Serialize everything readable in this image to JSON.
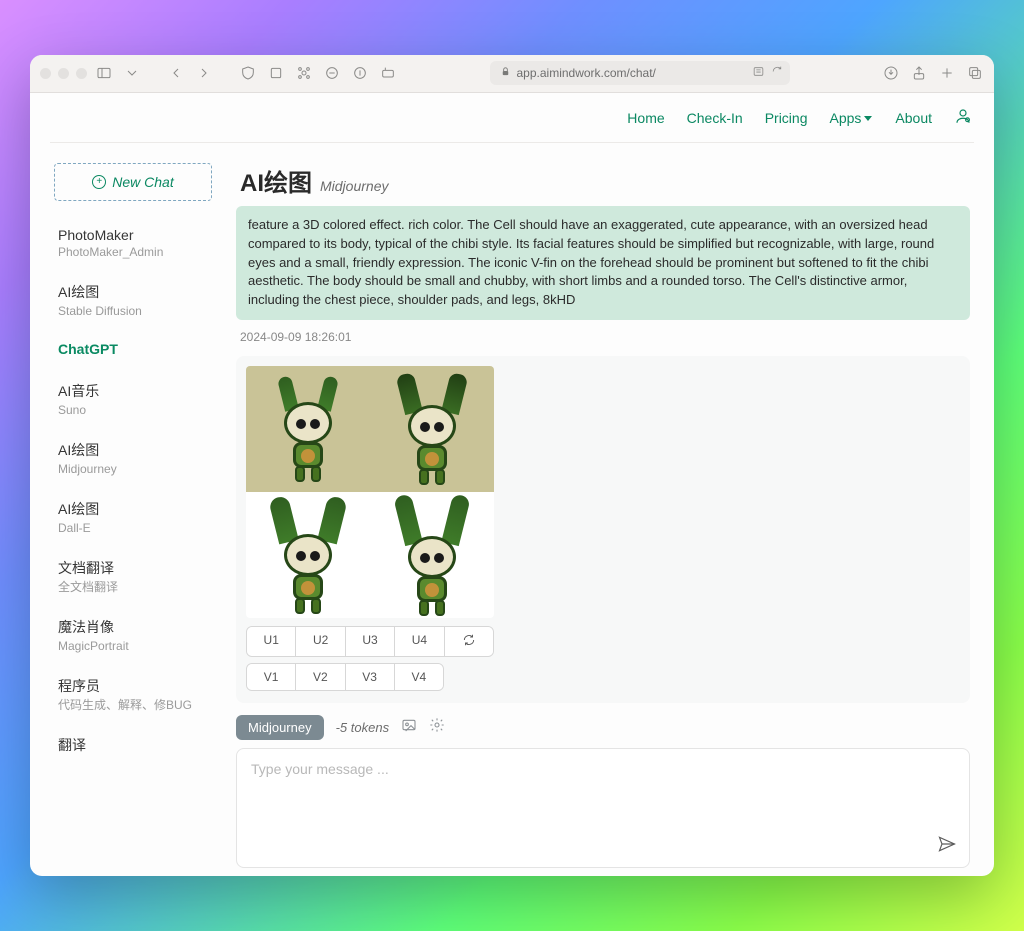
{
  "browser": {
    "url": "app.aimindwork.com/chat/"
  },
  "nav": {
    "home": "Home",
    "checkin": "Check-In",
    "pricing": "Pricing",
    "apps": "Apps",
    "about": "About"
  },
  "sidebar": {
    "new_chat": "New Chat",
    "items": [
      {
        "title": "PhotoMaker",
        "sub": "PhotoMaker_Admin",
        "active": false
      },
      {
        "title": "AI绘图",
        "sub": "Stable Diffusion",
        "active": false
      },
      {
        "title": "ChatGPT",
        "sub": "",
        "active": true
      },
      {
        "title": "AI音乐",
        "sub": "Suno",
        "active": false
      },
      {
        "title": "AI绘图",
        "sub": "Midjourney",
        "active": false
      },
      {
        "title": "AI绘图",
        "sub": "Dall-E",
        "active": false
      },
      {
        "title": "文档翻译",
        "sub": "全文档翻译",
        "active": false
      },
      {
        "title": "魔法肖像",
        "sub": "MagicPortrait",
        "active": false
      },
      {
        "title": "程序员",
        "sub": "代码生成、解释、修BUG",
        "active": false
      },
      {
        "title": "翻译",
        "sub": "",
        "active": false
      }
    ]
  },
  "page": {
    "title": "AI绘图",
    "subtitle": "Midjourney",
    "prompt": "feature a 3D colored effect. rich color. The Cell should have an exaggerated, cute appearance, with an oversized head compared to its body, typical of the chibi style. Its facial features should be simplified but recognizable, with large, round eyes and a small, friendly expression. The iconic V-fin on the forehead should be prominent but softened to fit the chibi aesthetic. The body should be small and chubby, with short limbs and a rounded torso. The Cell's distinctive armor, including the chest piece, shoulder pads, and legs, 8kHD",
    "timestamp": "2024-09-09 18:26:01",
    "u_buttons": [
      "U1",
      "U2",
      "U3",
      "U4"
    ],
    "v_buttons": [
      "V1",
      "V2",
      "V3",
      "V4"
    ]
  },
  "composer": {
    "model": "Midjourney",
    "tokens": "-5 tokens",
    "placeholder": "Type your message ..."
  }
}
